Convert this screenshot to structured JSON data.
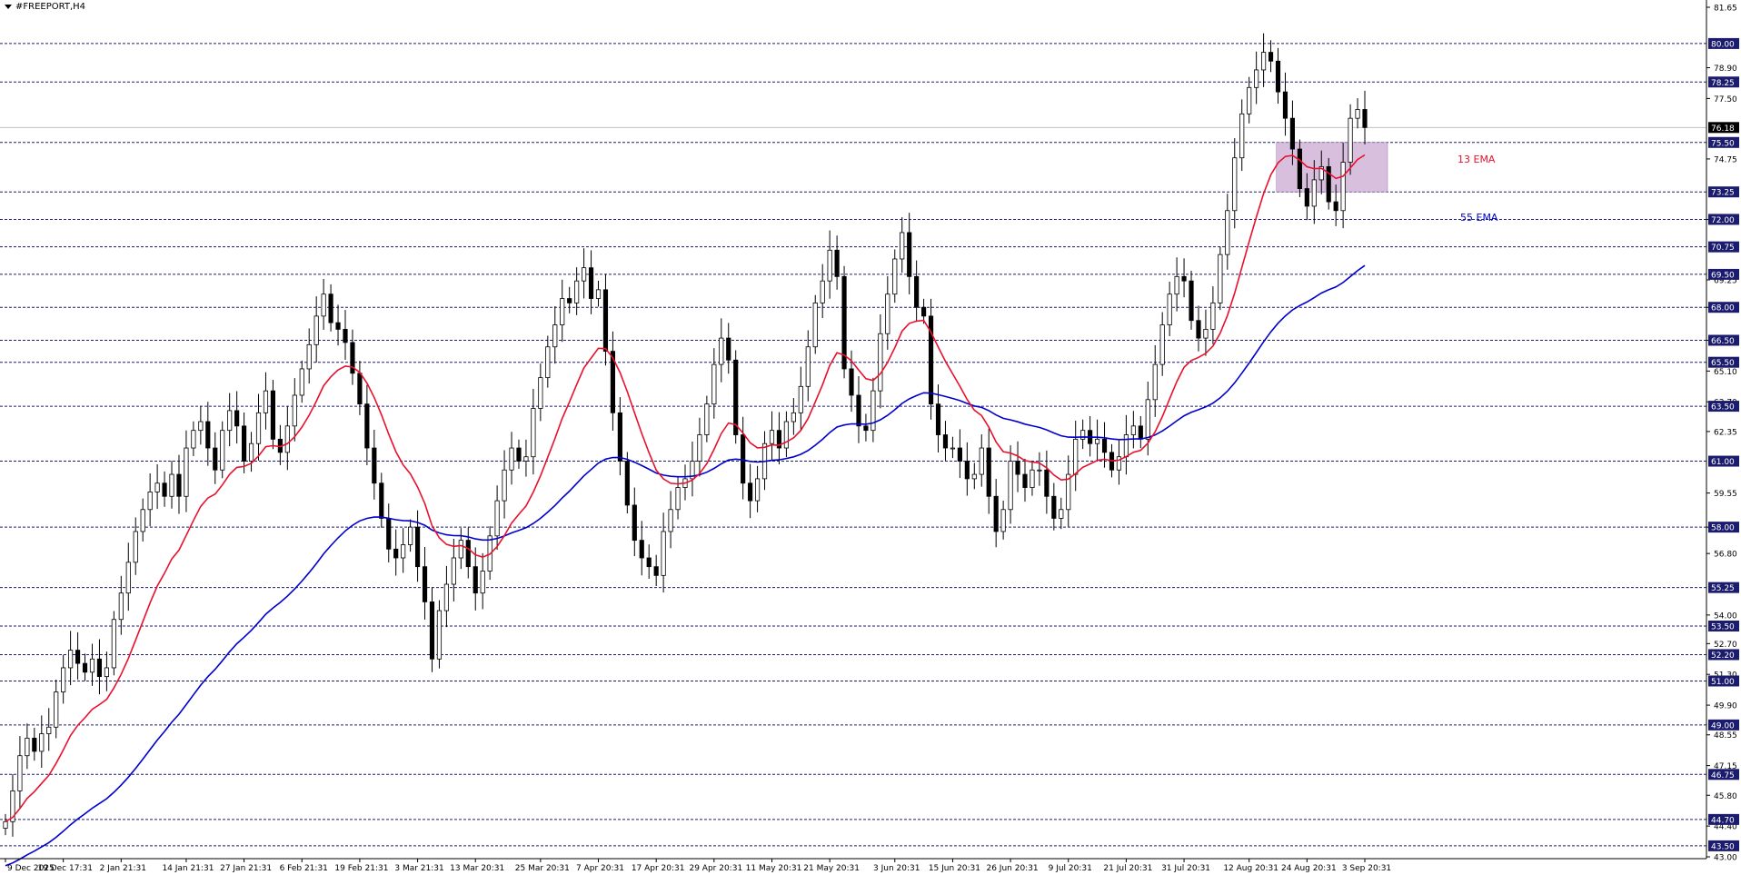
{
  "window": {
    "symbol_title": "#FREEPORT,H4",
    "menu_icon": "triangle-down-icon"
  },
  "labels": {
    "ema13": "13 EMA",
    "ema55": "55 EMA"
  },
  "colors": {
    "background": "#ffffff",
    "ema13": "#e8112d",
    "ema55": "#0000cc",
    "level_line": "#1c1c6e",
    "level_tag_bg": "#1c1c6e",
    "zone_fill": "#c9a9d2",
    "candle": "#000000",
    "current_price_line": "#c0c0c0"
  },
  "chart_data": {
    "type": "candlestick",
    "title": "#FREEPORT,H4",
    "ylim": [
      43.0,
      81.65
    ],
    "y_scale_labels": [
      "81.65",
      "78.90",
      "77.50",
      "74.75",
      "72.00",
      "69.25",
      "68.00",
      "66.50",
      "65.10",
      "63.70",
      "62.35",
      "59.55",
      "58.00",
      "56.80",
      "54.00",
      "52.70",
      "51.30",
      "49.90",
      "48.55",
      "47.15",
      "45.80",
      "44.40",
      "43.00"
    ],
    "levels": [
      80.0,
      78.25,
      75.5,
      73.25,
      72.0,
      70.75,
      69.5,
      68.0,
      66.5,
      65.5,
      63.5,
      61.0,
      58.0,
      55.25,
      53.5,
      52.2,
      51.0,
      49.0,
      46.75,
      44.7,
      43.5
    ],
    "level_labels": [
      "80.00",
      "78.25",
      "75.50",
      "73.25",
      "72.00",
      "70.75",
      "69.50",
      "68.00",
      "66.50",
      "65.50",
      "63.50",
      "61.00",
      "58.00",
      "55.25",
      "53.50",
      "52.20",
      "51.00",
      "49.00",
      "46.75",
      "44.70",
      "43.50"
    ],
    "current_price": 76.18,
    "current_price_label": "76.18",
    "x_labels": [
      "9 Dec 2025",
      "19 Dec 17:31",
      "2 Jan 21:31",
      "14 Jan 21:31",
      "27 Jan 21:31",
      "6 Feb 21:31",
      "19 Feb 21:31",
      "3 Mar 21:31",
      "13 Mar 20:31",
      "25 Mar 20:31",
      "7 Apr 20:31",
      "17 Apr 20:31",
      "29 Apr 20:31",
      "11 May 20:31",
      "21 May 20:31",
      "3 Jun 20:31",
      "15 Jun 20:31",
      "26 Jun 20:31",
      "9 Jul 20:31",
      "21 Jul 20:31",
      "31 Jul 20:31",
      "12 Aug 20:31",
      "24 Aug 20:31",
      "3 Sep 20:31"
    ],
    "zone": {
      "from_label": "12 Aug 20:31",
      "to_label": "3 Sep 20:31",
      "y_low": 73.25,
      "y_high": 75.5
    },
    "closes": [
      44.6,
      46.0,
      47.6,
      48.4,
      47.8,
      48.6,
      48.9,
      50.5,
      51.6,
      52.4,
      51.8,
      51.4,
      52.0,
      51.2,
      51.6,
      53.8,
      55.0,
      56.4,
      57.8,
      58.8,
      59.6,
      60.0,
      59.4,
      60.4,
      59.4,
      61.6,
      62.4,
      62.8,
      61.6,
      60.6,
      62.4,
      63.3,
      62.6,
      61.0,
      61.8,
      63.2,
      64.2,
      62.0,
      61.4,
      62.6,
      64.0,
      65.2,
      66.3,
      67.6,
      68.6,
      67.3,
      67.0,
      66.4,
      65.0,
      63.6,
      61.6,
      60.0,
      58.4,
      57.0,
      56.6,
      57.2,
      58.0,
      56.2,
      54.6,
      52.0,
      54.2,
      55.4,
      56.6,
      57.4,
      56.2,
      55.0,
      56.0,
      57.6,
      59.2,
      60.6,
      61.6,
      61.0,
      61.2,
      63.4,
      64.8,
      66.2,
      67.2,
      68.4,
      68.2,
      69.2,
      69.8,
      68.4,
      68.8,
      66.0,
      63.2,
      61.0,
      59.0,
      57.4,
      56.6,
      56.2,
      55.8,
      57.8,
      58.8,
      59.8,
      60.2,
      61.0,
      62.2,
      63.6,
      65.4,
      66.6,
      65.6,
      62.2,
      60.0,
      59.2,
      60.2,
      61.8,
      62.4,
      61.6,
      62.8,
      63.2,
      64.4,
      66.2,
      68.2,
      69.2,
      70.6,
      69.4,
      65.2,
      64.0,
      62.6,
      62.4,
      64.2,
      66.8,
      68.6,
      70.2,
      71.4,
      69.4,
      68.0,
      67.6,
      63.6,
      62.2,
      61.6,
      61.6,
      61.0,
      60.2,
      60.4,
      61.6,
      59.4,
      57.8,
      58.8,
      61.0,
      60.4,
      59.8,
      60.6,
      60.6,
      59.4,
      58.4,
      58.8,
      60.4,
      62.0,
      62.4,
      61.8,
      62.0,
      61.4,
      60.6,
      61.2,
      62.2,
      62.6,
      62.0,
      63.8,
      65.4,
      67.2,
      68.6,
      69.4,
      69.2,
      67.4,
      66.6,
      67.0,
      68.2,
      70.4,
      72.4,
      74.8,
      76.8,
      78.0,
      78.8,
      79.6,
      79.2,
      77.8,
      76.6,
      75.2,
      73.4,
      72.6,
      73.8,
      74.4,
      72.8,
      72.4,
      74.6,
      76.6,
      77.0,
      76.18
    ]
  }
}
